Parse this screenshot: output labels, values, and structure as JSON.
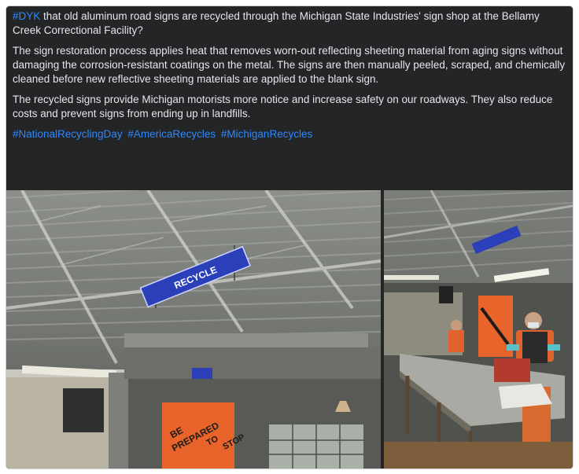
{
  "post": {
    "paragraphs": {
      "first": {
        "tag": "#DYK",
        "text": " that old aluminum road signs are recycled through the Michigan State Industries' sign shop at the Bellamy Creek Correctional Facility?"
      },
      "second": "The sign restoration process applies heat that removes worn-out reflecting sheeting material from aging signs without damaging the corrosion-resistant coatings on the metal. The signs are then manually peeled, scraped, and chemically cleaned before new reflective sheeting materials are applied to the blank sign.",
      "third": "The recycled signs provide Michigan motorists more notice and increase safety on our roadways. They also reduce costs and prevent signs from ending up in landfills."
    },
    "hashtags": [
      "#NationalRecyclingDay",
      "#AmericaRecycles",
      "#MichiganRecycles"
    ]
  },
  "photos": {
    "left": {
      "sign_text": "RECYCLE",
      "poster_words": [
        "BE",
        "PREPARED",
        "TO",
        "STOP"
      ]
    },
    "right": {}
  },
  "colors": {
    "card_bg": "#242526",
    "text": "#e4e6eb",
    "link": "#2d88ff",
    "sign_blue": "#2a3fb8",
    "safety_orange": "#e8642a"
  }
}
